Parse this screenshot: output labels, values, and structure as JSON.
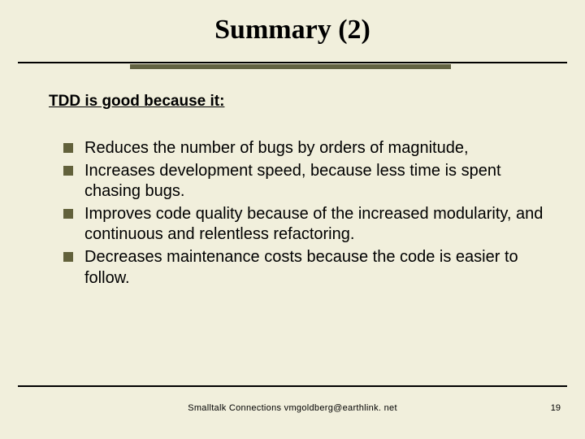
{
  "title": "Summary (2)",
  "subhead": "TDD is good because it:",
  "bullets": [
    "Reduces the number of bugs by orders of magnitude,",
    "Increases development speed, because less time is spent chasing bugs.",
    "Improves code quality because of the increased modularity, and continuous and relentless refactoring.",
    "Decreases maintenance costs because the code is easier to follow."
  ],
  "footer": "Smalltalk Connections  vmgoldberg@earthlink. net",
  "page_number": "19",
  "colors": {
    "background": "#f1efdc",
    "bullet_square": "#62613b",
    "accent_bar": "#626241"
  }
}
